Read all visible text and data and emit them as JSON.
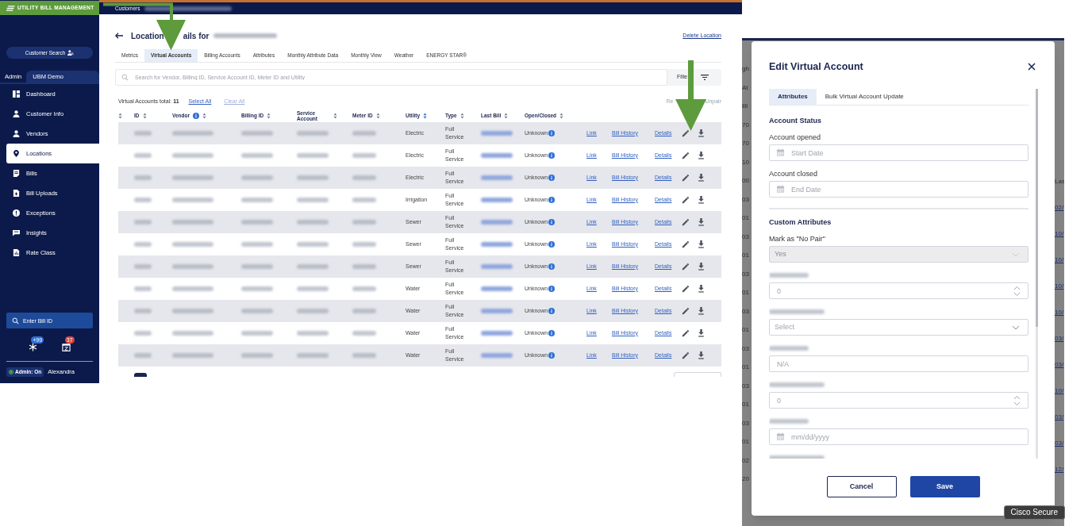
{
  "brand": {
    "title": "UTILITY BILL MANAGEMENT"
  },
  "breadcrumb": {
    "label": "Customers"
  },
  "sidebar": {
    "customer_search": "Customer Search",
    "tabs": [
      {
        "label": "Admin",
        "selected": false
      },
      {
        "label": "UBM Demo",
        "selected": true
      }
    ],
    "items": [
      {
        "label": "Dashboard",
        "selected": false
      },
      {
        "label": "Customer Info",
        "selected": false
      },
      {
        "label": "Vendors",
        "selected": false
      },
      {
        "label": "Locations",
        "selected": true
      },
      {
        "label": "Bills",
        "selected": false
      },
      {
        "label": "Bill Uploads",
        "selected": false
      },
      {
        "label": "Exceptions",
        "selected": false
      },
      {
        "label": "Insights",
        "selected": false
      },
      {
        "label": "Rate Class",
        "selected": false
      }
    ],
    "bill_id_search": {
      "placeholder": "Enter Bill ID"
    },
    "badges": [
      {
        "count": "+99",
        "color": "#2f6fd6"
      },
      {
        "count": "37",
        "color": "#d9453d"
      }
    ],
    "admin_toggle": {
      "label": "Admin: On",
      "on": true
    },
    "user": "Alexandra"
  },
  "page": {
    "title_parts": [
      "Location",
      "ails for"
    ],
    "delete_link": "Delete Location",
    "tabs": [
      {
        "label": "Metrics",
        "selected": false
      },
      {
        "label": "Virtual Accounts",
        "selected": true
      },
      {
        "label": "Billing Accounts",
        "selected": false
      },
      {
        "label": "Attributes",
        "selected": false
      },
      {
        "label": "Monthly Attribute Data",
        "selected": false
      },
      {
        "label": "Monthly View",
        "selected": false
      },
      {
        "label": "Weather",
        "selected": false
      },
      {
        "label": "ENERGY STAR®",
        "selected": false
      }
    ],
    "search": {
      "placeholder": "Search for Vendor, Billing ID, Service Account ID, Meter ID and Utility"
    },
    "filters_button": "Filte",
    "total": {
      "label": "Virtual Accounts total:",
      "count": "11"
    },
    "select_all": "Select All",
    "clear_all": {
      "label": "Clear All",
      "disabled": true
    },
    "bulk_actions": [
      {
        "label": "Re",
        "disabled": true
      },
      {
        "label": "Unpair",
        "disabled": true
      }
    ]
  },
  "table": {
    "columns": [
      {
        "sorted": false
      },
      {
        "label": "ID",
        "sorted": false
      },
      {
        "label": "Vendor",
        "info": true,
        "sorted": false
      },
      {
        "label": "Billing ID",
        "sorted": false
      },
      {
        "label": "Service Account",
        "sorted": false
      },
      {
        "label": "Meter ID",
        "sorted": false
      },
      {
        "label": "Utility",
        "sorted": true
      },
      {
        "label": "Type",
        "sorted": false
      },
      {
        "label": "Last Bill",
        "sorted": false
      },
      {
        "label": "Open/Closed",
        "sorted": false
      }
    ],
    "rows": [
      {
        "utility": "Electric",
        "type": "Full Service",
        "status": "Unknown",
        "actions": [
          "Link",
          "Bill History",
          "Details"
        ]
      },
      {
        "utility": "Electric",
        "type": "Full Service",
        "status": "Unknown",
        "actions": [
          "Link",
          "Bill History",
          "Details"
        ]
      },
      {
        "utility": "Electric",
        "type": "Full Service",
        "status": "Unknown",
        "actions": [
          "Link",
          "Bill History",
          "Details"
        ]
      },
      {
        "utility": "Irrigation",
        "type": "Full Service",
        "status": "Unknown",
        "actions": [
          "Link",
          "Bill History",
          "Details"
        ]
      },
      {
        "utility": "Sewer",
        "type": "Full Service",
        "status": "Unknown",
        "actions": [
          "Link",
          "Bill History",
          "Details"
        ]
      },
      {
        "utility": "Sewer",
        "type": "Full Service",
        "status": "Unknown",
        "actions": [
          "Link",
          "Bill History",
          "Details"
        ]
      },
      {
        "utility": "Sewer",
        "type": "Full Service",
        "status": "Unknown",
        "actions": [
          "Link",
          "Bill History",
          "Details"
        ]
      },
      {
        "utility": "Water",
        "type": "Full Service",
        "status": "Unknown",
        "actions": [
          "Link",
          "Bill History",
          "Details"
        ]
      },
      {
        "utility": "Water",
        "type": "Full Service",
        "status": "Unknown",
        "actions": [
          "Link",
          "Bill History",
          "Details"
        ]
      },
      {
        "utility": "Water",
        "type": "Full Service",
        "status": "Unknown",
        "actions": [
          "Link",
          "Bill History",
          "Details"
        ]
      },
      {
        "utility": "Water",
        "type": "Full Service",
        "status": "Unknown",
        "actions": [
          "Link",
          "Bill History",
          "Details"
        ]
      }
    ]
  },
  "annotations": [
    {
      "kind": "elbow-arrow"
    },
    {
      "kind": "arrow"
    }
  ],
  "background": {
    "left_fragments": [
      "gh",
      "At",
      "illi",
      "70",
      "70",
      "10",
      "00",
      "03",
      "01",
      "03",
      "01",
      "03",
      "01",
      "03",
      "01",
      "03",
      "01",
      "03",
      "01",
      "03",
      "01",
      "02",
      "20"
    ],
    "right_fragments": [
      "Las",
      "02/",
      "10/",
      "10/",
      "10/",
      "10/",
      "03/",
      "03/",
      "10/",
      "03/",
      "03/",
      "12/"
    ]
  },
  "modal": {
    "title": "Edit Virtual Account",
    "tabs": [
      {
        "label": "Attributes",
        "selected": true
      },
      {
        "label": "Bulk Virtual Account Update",
        "selected": false
      }
    ],
    "sections": [
      {
        "heading": "Account Status",
        "fields": [
          {
            "kind": "date",
            "label": "Account opened",
            "placeholder": "Start Date"
          },
          {
            "kind": "date",
            "label": "Account closed",
            "placeholder": "End Date"
          }
        ]
      },
      {
        "heading": "Custom Attributes",
        "fields": [
          {
            "kind": "select",
            "label": "Mark as \"No Pair\"",
            "value": "Yes",
            "disabled": true
          },
          {
            "kind": "number",
            "label_blurred": true,
            "placeholder": "0"
          },
          {
            "kind": "select",
            "label_blurred": true,
            "placeholder": "Select",
            "disabled": false
          },
          {
            "kind": "text",
            "label_blurred": true,
            "placeholder": "N/A"
          },
          {
            "kind": "number",
            "label_blurred": true,
            "placeholder": "0"
          },
          {
            "kind": "date",
            "label_blurred": true,
            "placeholder": "mm/dd/yyyy"
          },
          {
            "kind": "label_only",
            "label_blurred": true
          }
        ]
      }
    ],
    "buttons": [
      {
        "label": "Cancel",
        "kind": "secondary"
      },
      {
        "label": "Save",
        "kind": "primary"
      }
    ]
  },
  "tooltip": {
    "label": "Cisco Secure"
  }
}
